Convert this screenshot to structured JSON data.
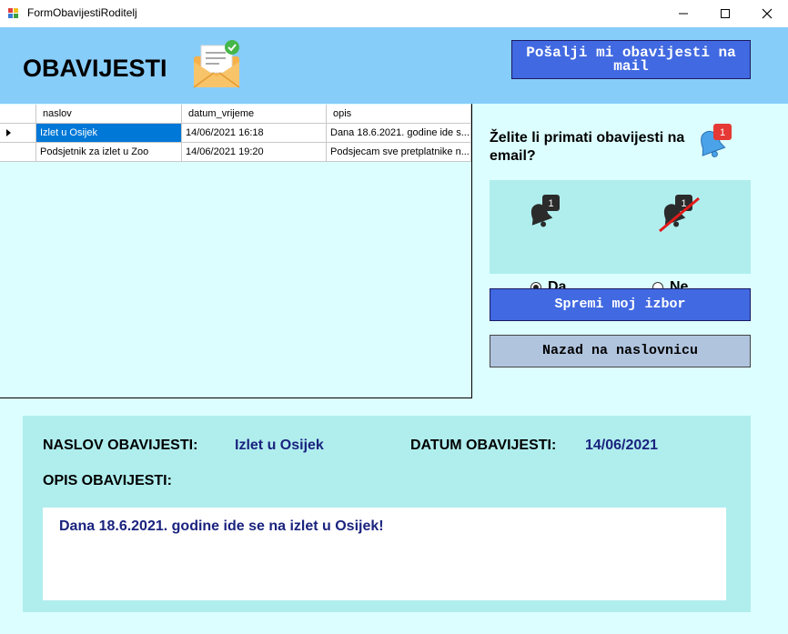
{
  "window": {
    "title": "FormObavijestiRoditelj",
    "controls": [
      "minimize",
      "maximize",
      "close"
    ]
  },
  "header": {
    "title": "OBAVIJESTI",
    "icon": "envelope-check-icon",
    "send_button": "Pošalji mi obavijesti na mail"
  },
  "grid": {
    "columns": [
      "naslov",
      "datum_vrijeme",
      "opis"
    ],
    "rows": [
      {
        "naslov": "Izlet u Osijek",
        "datum_vrijeme": "14/06/2021 16:18",
        "opis": "Dana 18.6.2021. godine ide s...",
        "selected": true
      },
      {
        "naslov": "Podsjetnik za izlet u Zoo",
        "datum_vrijeme": "14/06/2021 19:20",
        "opis": "Podsjecam sve pretplatnike n...",
        "selected": false
      }
    ]
  },
  "email_pref": {
    "question": "Želite li primati obavijesti na email?",
    "bell_badge": "1",
    "options": [
      {
        "label": "Da",
        "icon": "bell-notification-icon",
        "checked": true
      },
      {
        "label": "Ne",
        "icon": "bell-crossed-icon",
        "checked": false
      }
    ],
    "save_button": "Spremi moj izbor",
    "back_button": "Nazad na naslovnicu"
  },
  "details": {
    "title_label": "NASLOV OBAVIJESTI:",
    "title_value": "Izlet u Osijek",
    "date_label": "DATUM OBAVIJESTI:",
    "date_value": "14/06/2021",
    "desc_label": "OPIS OBAVIJESTI:",
    "desc_value": "Dana 18.6.2021. godine ide se na izlet u Osijek!"
  },
  "colors": {
    "header_bg": "#87cdfa",
    "client_bg": "#dcfefe",
    "panel_bg": "#b0eeee",
    "primary_button": "#4169e1",
    "secondary_button": "#b0c4de",
    "selection": "#0078d7",
    "value_text": "#1a237e"
  }
}
